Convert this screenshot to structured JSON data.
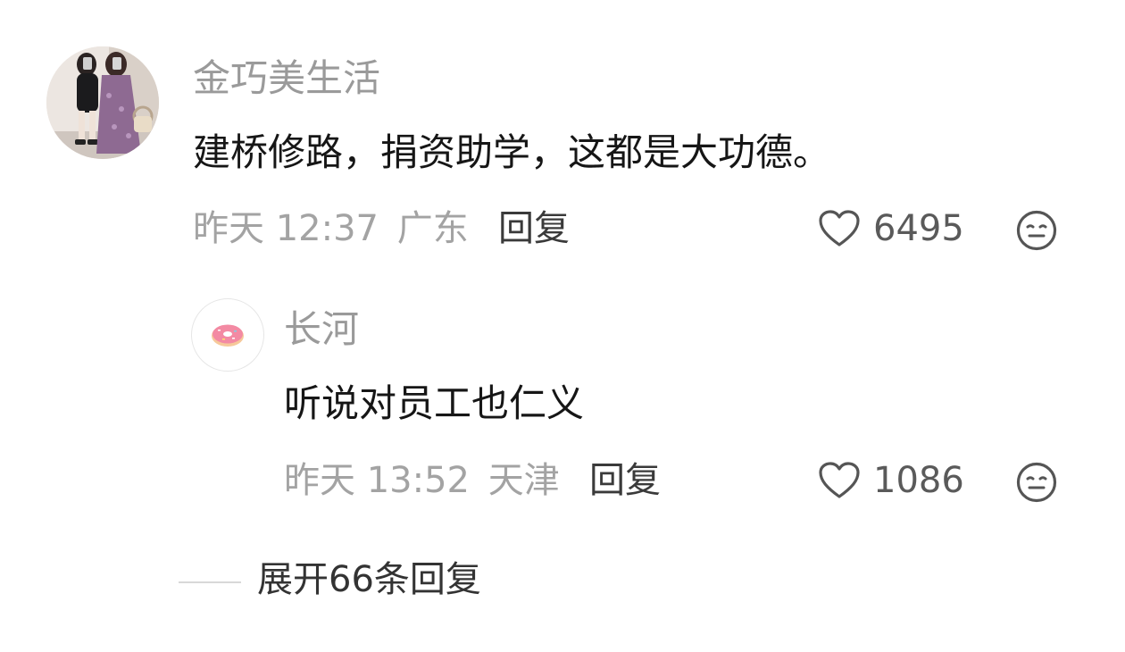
{
  "comment": {
    "username": "金巧美生活",
    "text": "建桥修路，捐资助学，这都是大功德。",
    "time": "昨天 12:37",
    "location": "广东",
    "reply_label": "回复",
    "likes": "6495",
    "avatar_icon": "avatar-photo-two-women"
  },
  "reply": {
    "username": "长河",
    "text": "听说对员工也仁义",
    "time": "昨天 13:52",
    "location": "天津",
    "reply_label": "回复",
    "likes": "1086",
    "avatar_icon": "donut-avatar"
  },
  "expand_replies": "展开66条回复",
  "icons": {
    "like": "heart-outline-icon",
    "react": "emoji-face-icon"
  }
}
